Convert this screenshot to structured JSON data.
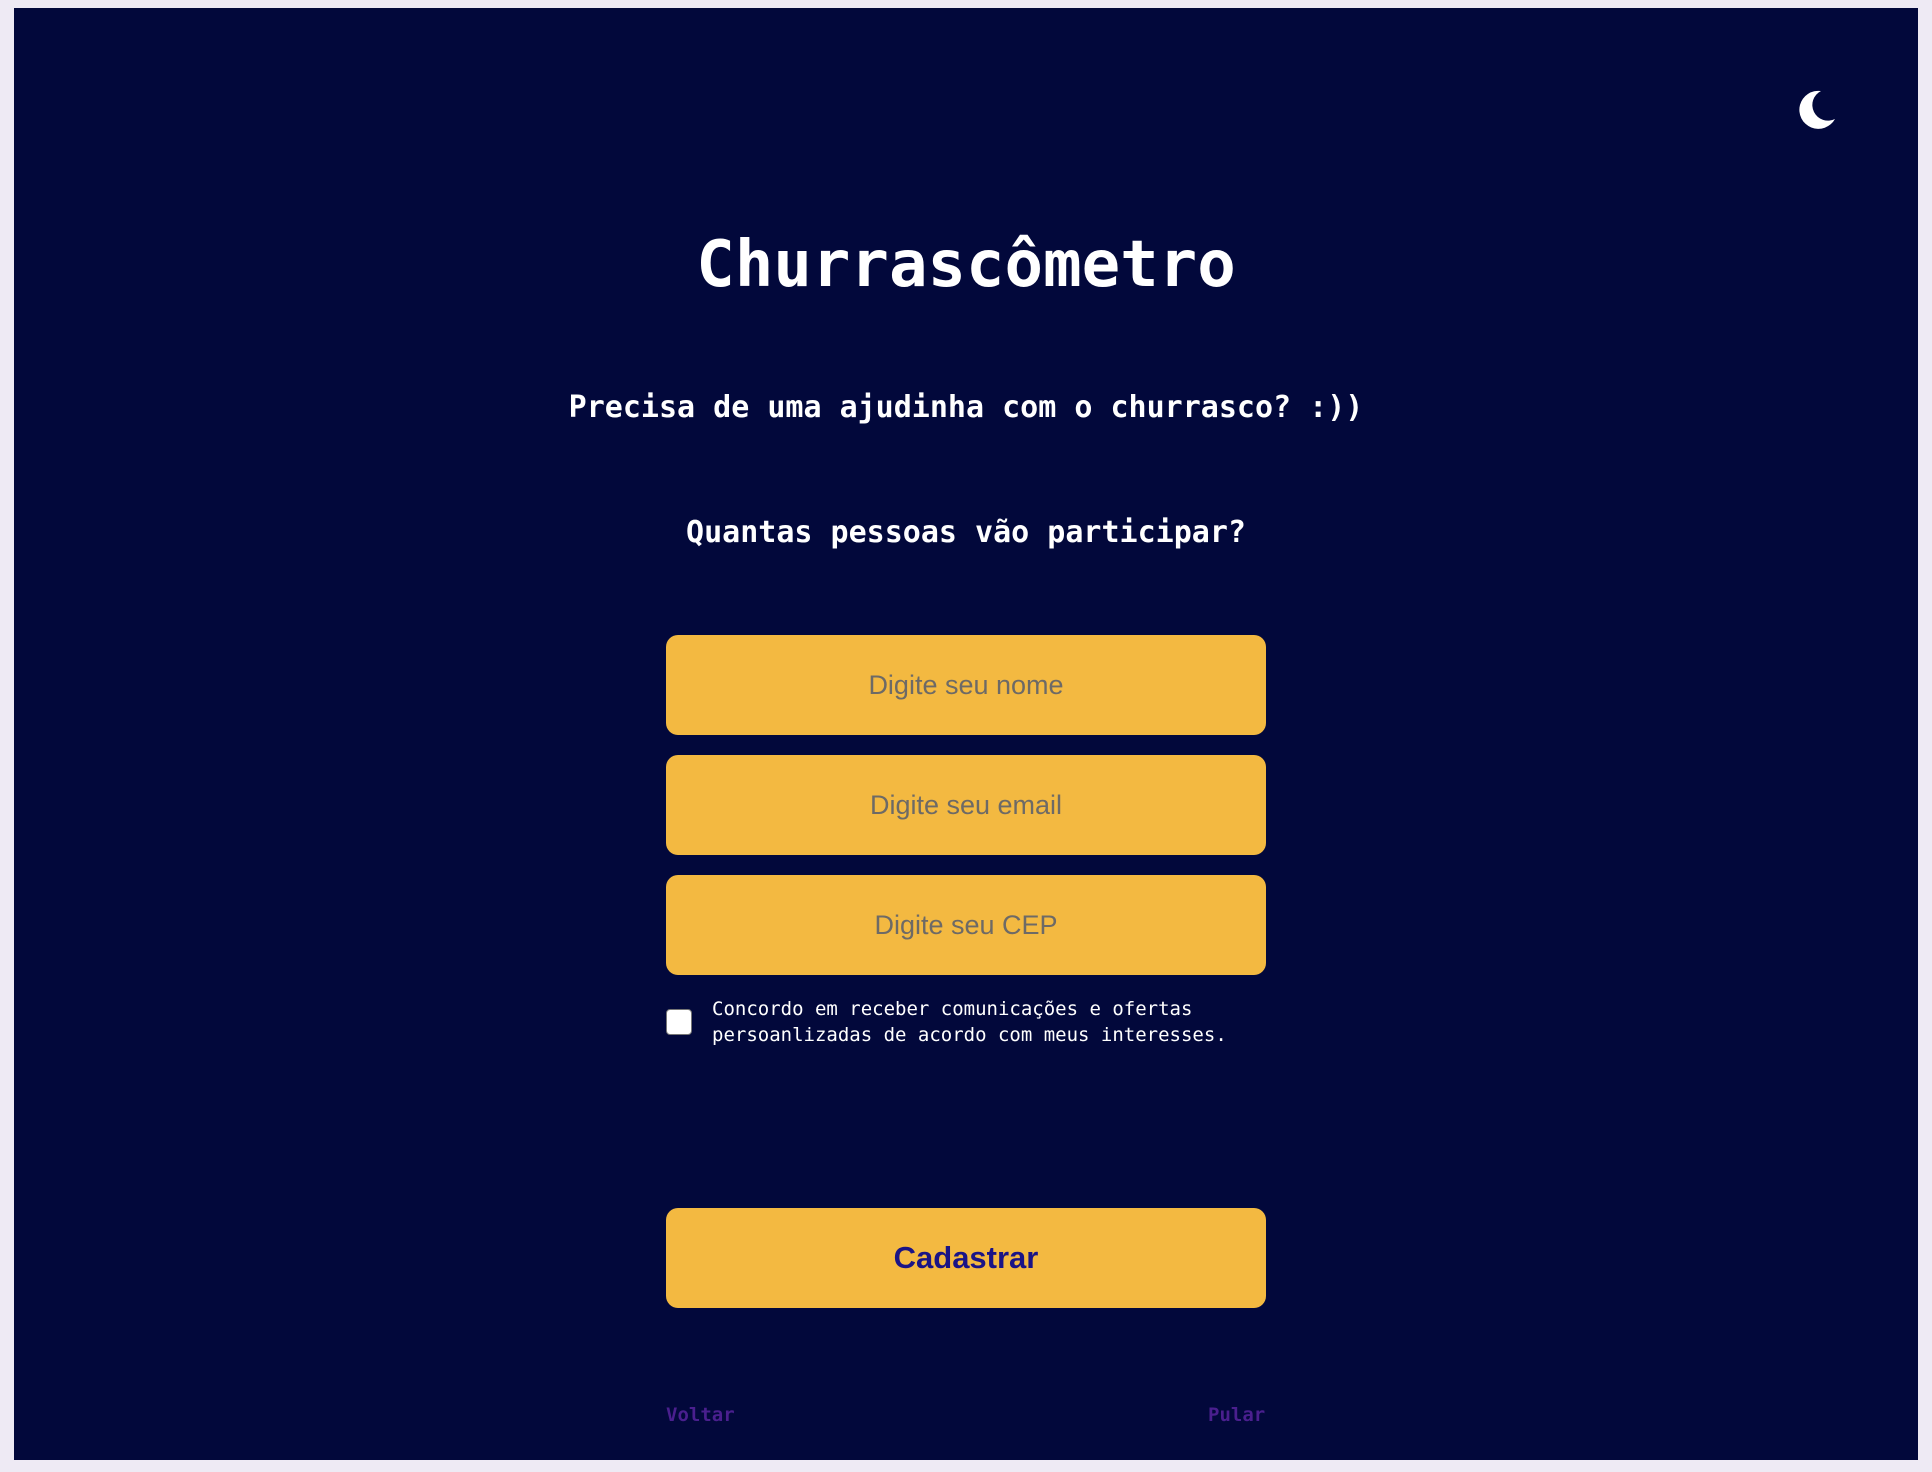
{
  "header": {
    "theme_toggle_icon": "moon-icon"
  },
  "main": {
    "title": "Churrascômetro",
    "subtitle": "Precisa de uma ajudinha com o churrasco? :))",
    "question": "Quantas pessoas vão participar?"
  },
  "form": {
    "name_placeholder": "Digite seu nome",
    "email_placeholder": "Digite seu email",
    "cep_placeholder": "Digite seu CEP",
    "consent_checked": false,
    "consent_label": "Concordo em receber comunicações e ofertas persoanlizadas de acordo com meus interesses.",
    "submit_label": "Cadastrar"
  },
  "navigation": {
    "back_label": "Voltar",
    "skip_label": "Pular"
  },
  "colors": {
    "background": "#02083b",
    "accent": "#f3b941",
    "button_text": "#1a1486",
    "link": "#4a1f8e"
  }
}
